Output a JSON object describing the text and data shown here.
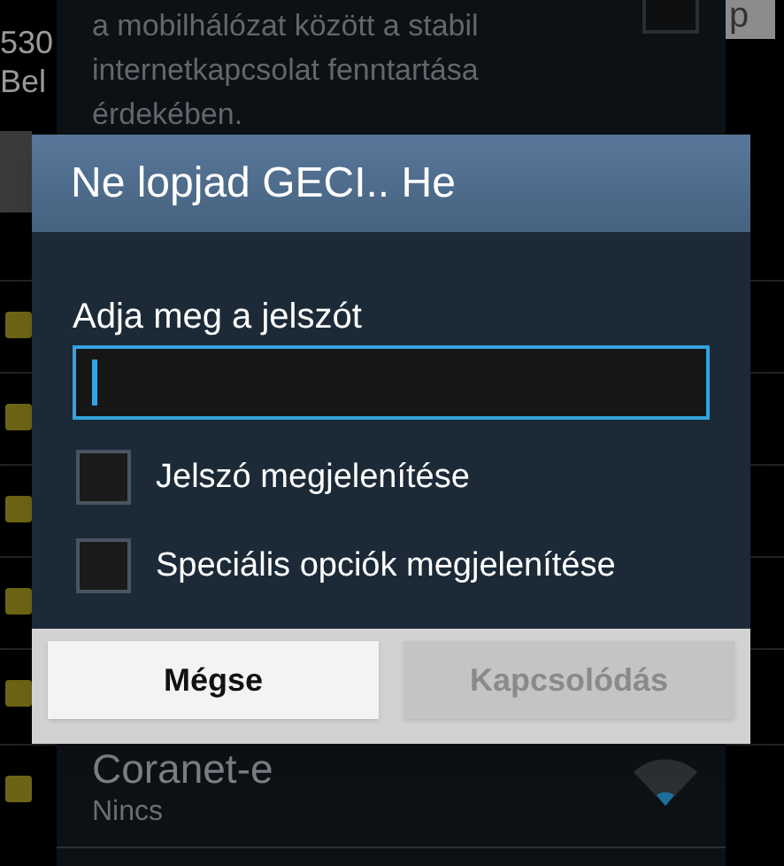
{
  "background_screen": {
    "texts": [
      "530",
      "Bel"
    ],
    "top_button": "p"
  },
  "settings_panel": {
    "description": "a mobilhálózat között a stabil internetkapcsolat fenntartása érdekében.",
    "checked": false,
    "network": {
      "name": "Coranet-e",
      "security": "Nincs"
    }
  },
  "dialog": {
    "title": "Ne lopjad GECI.. He",
    "password_label": "Adja meg a jelszót",
    "options": [
      {
        "label": "Jelszó megjelenítése",
        "checked": false
      },
      {
        "label": "Speciális opciók megjelenítése",
        "checked": false
      }
    ],
    "buttons": [
      {
        "label": "Mégse",
        "disabled": false
      },
      {
        "label": "Kapcsolódás",
        "disabled": true
      }
    ]
  }
}
